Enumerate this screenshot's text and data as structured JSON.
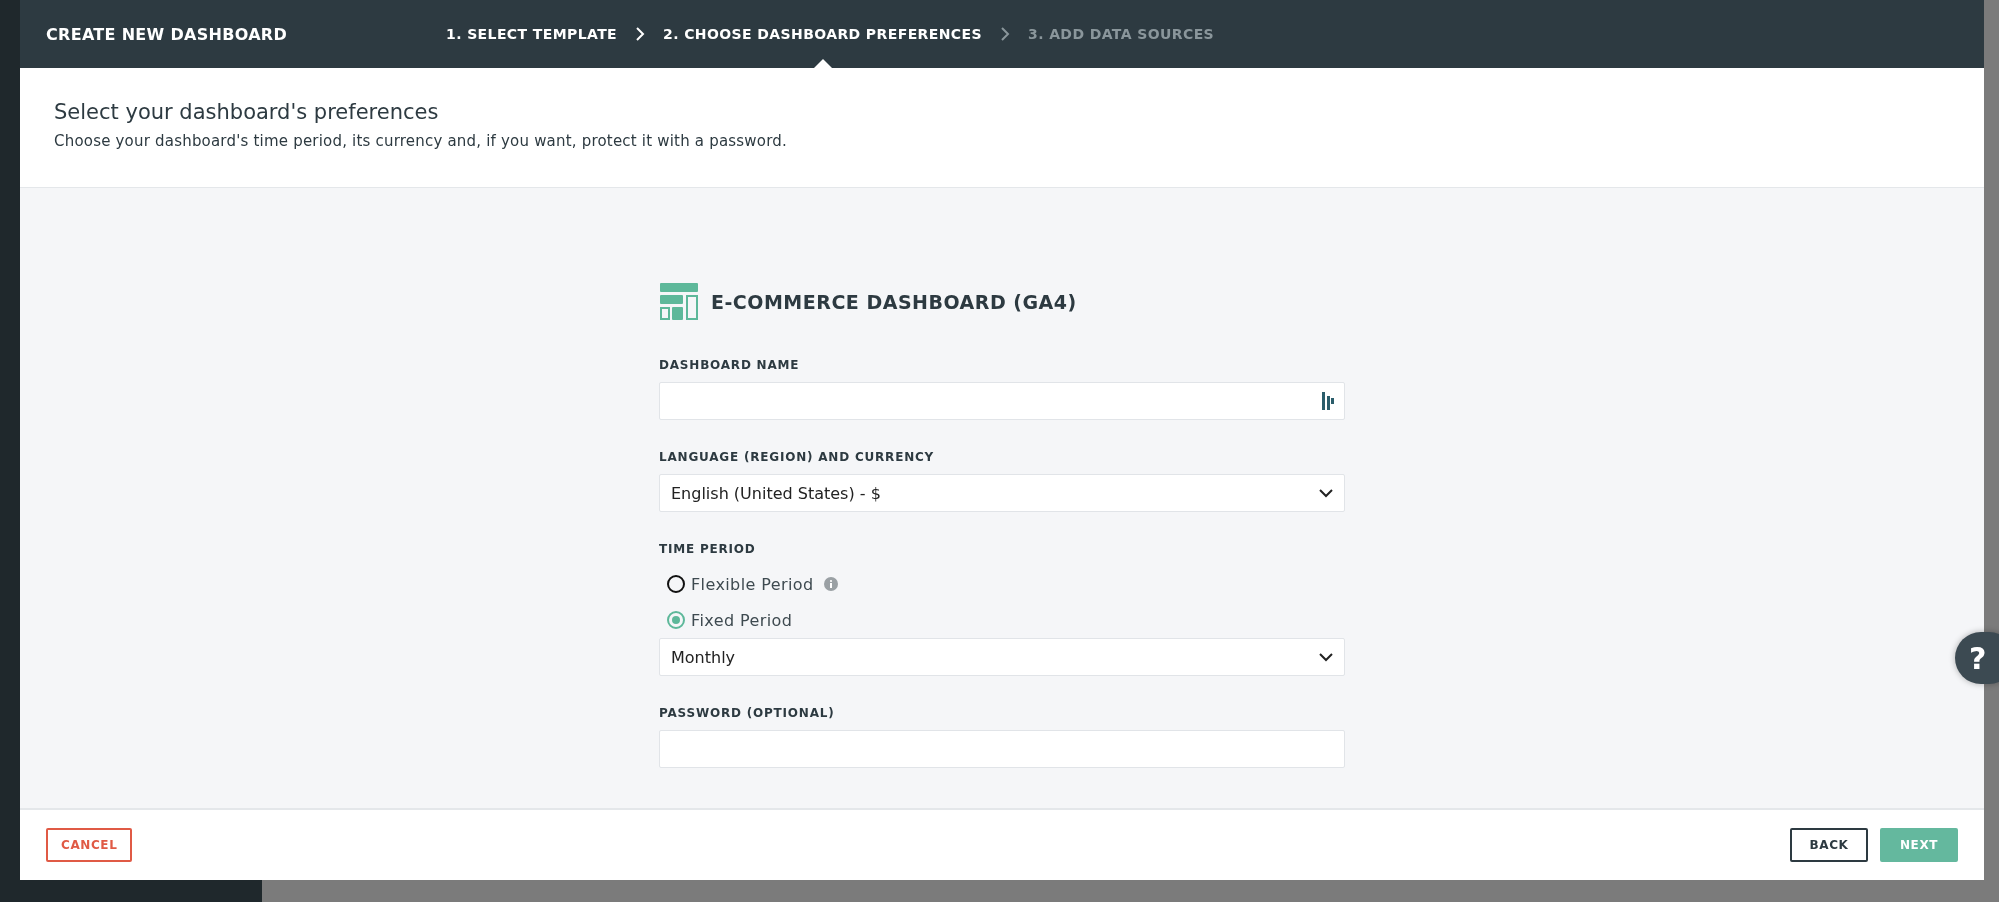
{
  "window": {
    "title": "CREATE NEW DASHBOARD"
  },
  "steps": [
    {
      "label": "1. SELECT TEMPLATE",
      "selected": false,
      "disabled": false
    },
    {
      "label": "2. CHOOSE DASHBOARD PREFERENCES",
      "selected": true,
      "disabled": false
    },
    {
      "label": "3. ADD DATA SOURCES",
      "selected": false,
      "disabled": true
    }
  ],
  "intro": {
    "heading": "Select your dashboard's preferences",
    "description": "Choose your dashboard's time period, its currency and, if you want, protect it with a password."
  },
  "form": {
    "template_name": "E-COMMERCE DASHBOARD (GA4)",
    "fields": [
      {
        "kind": "text",
        "label": "DASHBOARD NAME"
      },
      {
        "kind": "select",
        "label": "LANGUAGE (REGION) AND CURRENCY",
        "value": "English (United States) - $"
      },
      {
        "kind": "radio",
        "label": "TIME PERIOD",
        "options": [
          {
            "label": "Flexible Period",
            "selected": false,
            "info": true
          },
          {
            "label": "Fixed Period",
            "selected": true,
            "info": false
          }
        ],
        "value": "Monthly"
      },
      {
        "kind": "password",
        "label": "PASSWORD (OPTIONAL)"
      }
    ]
  },
  "footer": {
    "cancel": "CANCEL",
    "back": "BACK",
    "next": "NEXT"
  },
  "help": {
    "label": "?"
  }
}
